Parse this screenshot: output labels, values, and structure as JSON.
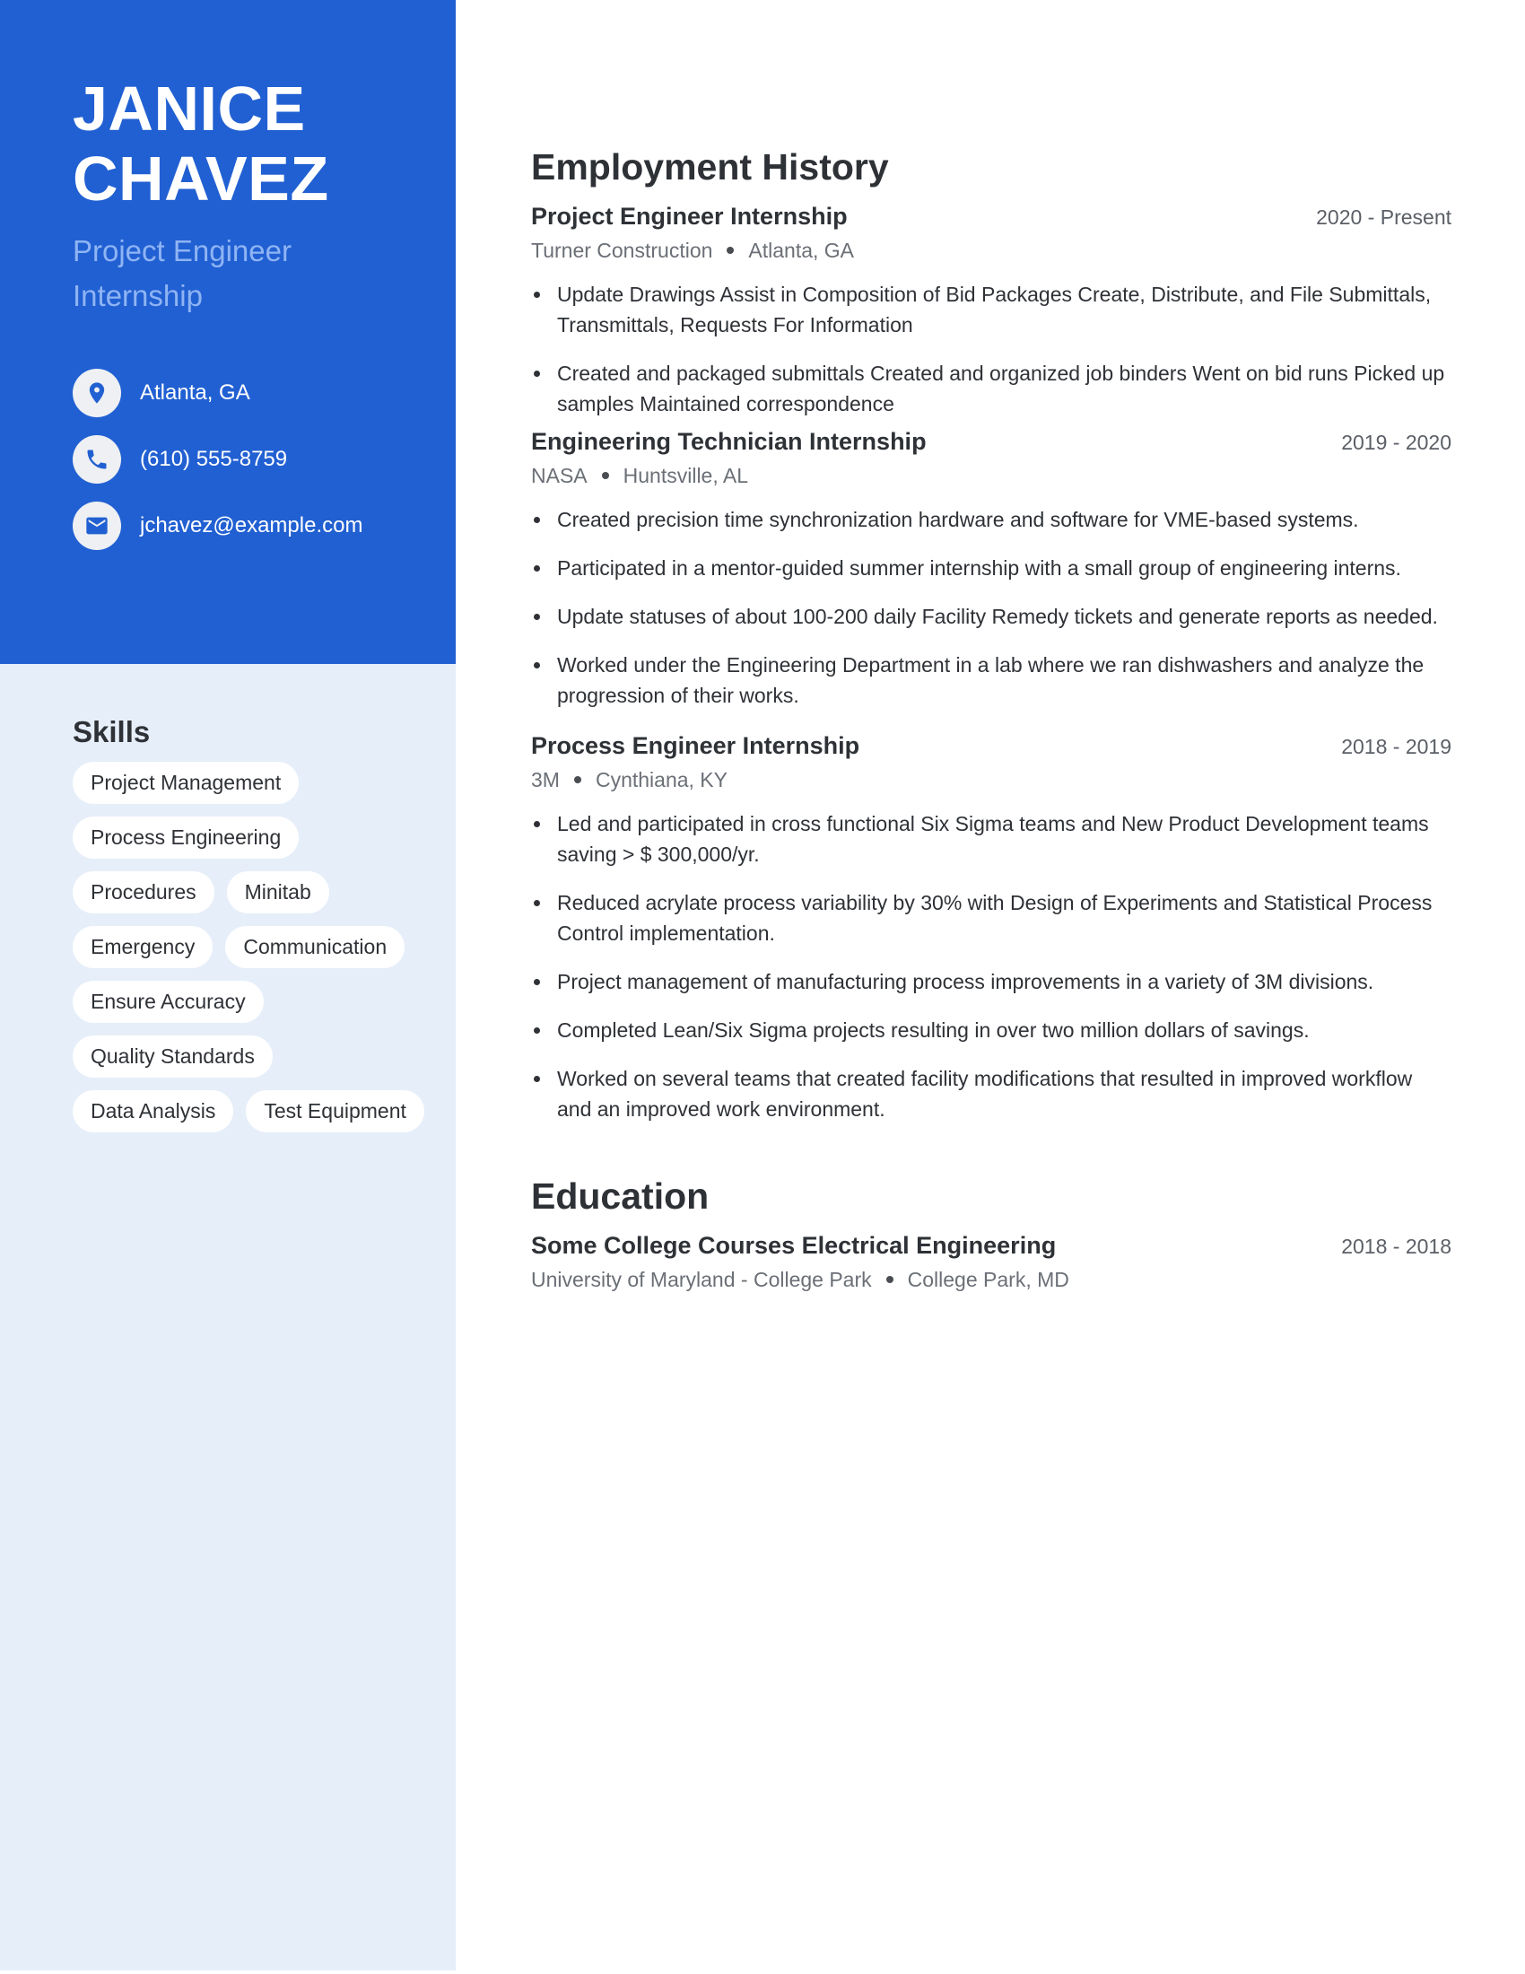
{
  "colors": {
    "accent": "#2160d2",
    "sidebar_bg": "#e6eef9",
    "headline": "#8fb4f4"
  },
  "profile": {
    "first_name": "JANICE",
    "last_name": "CHAVEZ",
    "headline": "Project Engineer Internship",
    "contacts": [
      {
        "icon": "map-pin-icon",
        "text": "Atlanta, GA"
      },
      {
        "icon": "phone-icon",
        "text": "(610) 555-8759"
      },
      {
        "icon": "mail-icon",
        "text": "jchavez@example.com"
      }
    ]
  },
  "skills": {
    "title": "Skills",
    "items": [
      "Project Management",
      "Process Engineering",
      "Procedures",
      "Minitab",
      "Emergency",
      "Communication",
      "Ensure Accuracy",
      "Quality Standards",
      "Data Analysis",
      "Test Equipment"
    ]
  },
  "employment": {
    "title": "Employment History",
    "jobs": [
      {
        "title": "Project Engineer Internship",
        "date": "2020 - Present",
        "company": "Turner Construction",
        "location": "Atlanta, GA",
        "bullets": [
          "Update Drawings Assist in Composition of Bid Packages Create, Distribute, and File Submittals, Transmittals, Requests For Information",
          "Created and packaged submittals Created and organized job binders Went on bid runs Picked up samples Maintained correspondence"
        ]
      },
      {
        "title": "Engineering Technician Internship",
        "date": "2019 - 2020",
        "company": "NASA",
        "location": "Huntsville, AL",
        "bullets": [
          "Created precision time synchronization hardware and software for VME-based systems.",
          "Participated in a mentor-guided summer internship with a small group of engineering interns.",
          "Update statuses of about 100-200 daily Facility Remedy tickets and generate reports as needed.",
          "Worked under the Engineering Department in a lab where we ran dishwashers and analyze the progression of their works."
        ]
      },
      {
        "title": "Process Engineer Internship",
        "date": "2018 - 2019",
        "company": "3M",
        "location": "Cynthiana, KY",
        "bullets": [
          "Led and participated in cross functional Six Sigma teams and New Product Development teams saving > $ 300,000/yr.",
          "Reduced acrylate process variability by 30% with Design of Experiments and Statistical Process Control implementation.",
          "Project management of manufacturing process improvements in a variety of 3M divisions.",
          "Completed Lean/Six Sigma projects resulting in over two million dollars of savings.",
          "Worked on several teams that created facility modifications that resulted in improved workflow and an improved work environment."
        ]
      }
    ]
  },
  "education": {
    "title": "Education",
    "entries": [
      {
        "title": "Some College Courses Electrical Engineering",
        "date": "2018 - 2018",
        "school": "University of Maryland - College Park",
        "location": "College Park, MD"
      }
    ]
  }
}
